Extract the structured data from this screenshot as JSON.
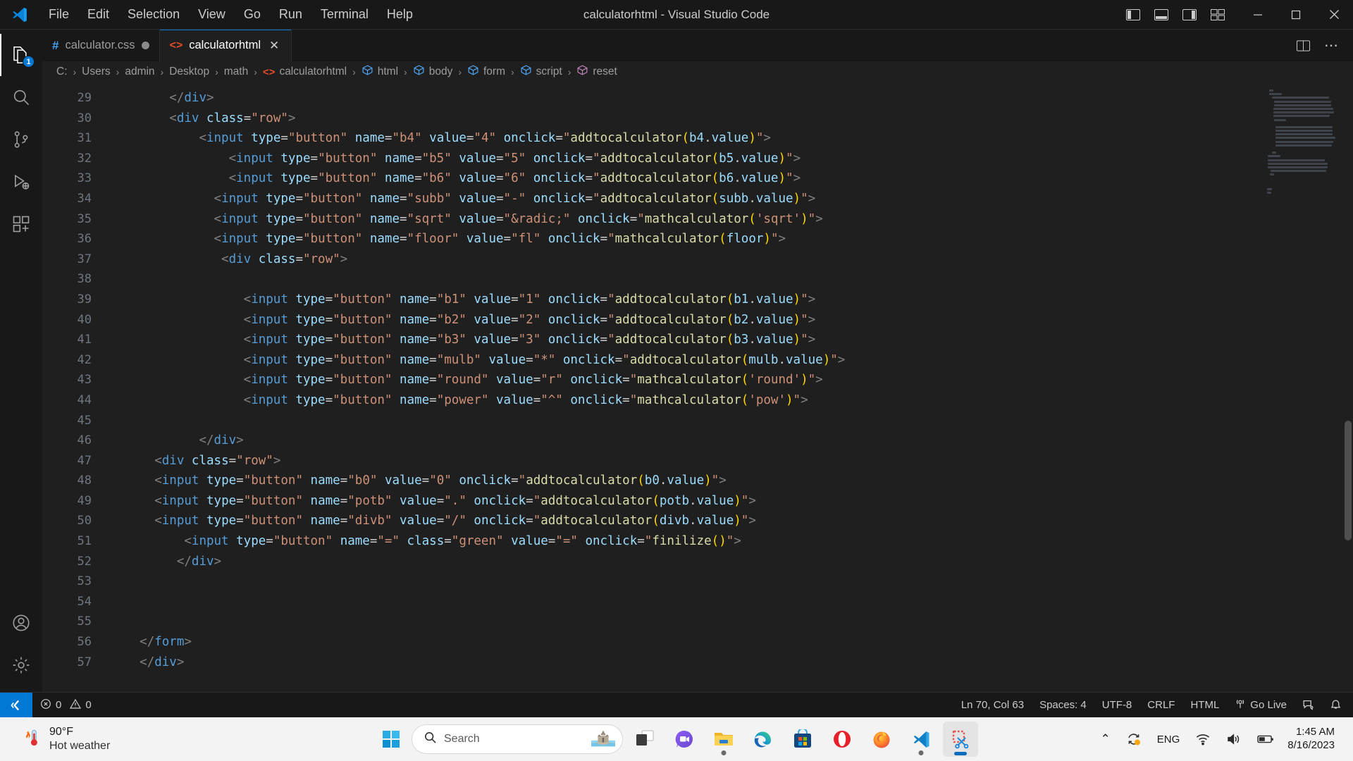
{
  "window": {
    "title": "calculatorhtml - Visual Studio Code",
    "menus": [
      "File",
      "Edit",
      "Selection",
      "View",
      "Go",
      "Run",
      "Terminal",
      "Help"
    ],
    "controls": {
      "minimize": "–",
      "maximize": "☐",
      "close": "✕"
    },
    "layout_icons": [
      "toggle-primary-sidebar-icon",
      "toggle-panel-icon",
      "toggle-secondary-sidebar-icon",
      "customize-layout-icon"
    ]
  },
  "activitybar": {
    "items": [
      {
        "name": "explorer",
        "badge": "1"
      },
      {
        "name": "search",
        "badge": ""
      },
      {
        "name": "source-control",
        "badge": ""
      },
      {
        "name": "run-and-debug",
        "badge": ""
      },
      {
        "name": "extensions",
        "badge": ""
      }
    ],
    "bottom": [
      {
        "name": "accounts"
      },
      {
        "name": "settings"
      }
    ]
  },
  "tabs": [
    {
      "label": "calculator.css",
      "icon": "css-file-icon",
      "dirty": true,
      "active": false
    },
    {
      "label": "calculatorhtml",
      "icon": "html-file-icon",
      "dirty": false,
      "active": true,
      "close": "✕"
    }
  ],
  "editor_actions": {
    "split_editor": "split-editor-icon",
    "more_actions": "⋯"
  },
  "breadcrumbs": [
    {
      "label": "C:",
      "icon": ""
    },
    {
      "label": "Users",
      "icon": ""
    },
    {
      "label": "admin",
      "icon": ""
    },
    {
      "label": "Desktop",
      "icon": ""
    },
    {
      "label": "math",
      "icon": ""
    },
    {
      "label": "calculatorhtml",
      "icon": "html-file-icon"
    },
    {
      "label": "html",
      "icon": "symbol-field-icon"
    },
    {
      "label": "body",
      "icon": "symbol-field-icon"
    },
    {
      "label": "form",
      "icon": "symbol-field-icon"
    },
    {
      "label": "script",
      "icon": "symbol-field-icon"
    },
    {
      "label": "reset",
      "icon": "symbol-object-icon"
    }
  ],
  "separator": "›",
  "code": {
    "first_line": 29,
    "lines": [
      {
        "n": 29,
        "text": "        </div>"
      },
      {
        "n": 30,
        "text": "        <div class=\"row\">"
      },
      {
        "n": 31,
        "text": "            <input type=\"button\" name=\"b4\" value=\"4\" onclick=\"addtocalculator(b4.value)\">"
      },
      {
        "n": 32,
        "text": "                <input type=\"button\" name=\"b5\" value=\"5\" onclick=\"addtocalculator(b5.value)\">"
      },
      {
        "n": 33,
        "text": "                <input type=\"button\" name=\"b6\" value=\"6\" onclick=\"addtocalculator(b6.value)\">"
      },
      {
        "n": 34,
        "text": "              <input type=\"button\" name=\"subb\" value=\"-\" onclick=\"addtocalculator(subb.value)\">"
      },
      {
        "n": 35,
        "text": "              <input type=\"button\" name=\"sqrt\" value=\"&radic;\" onclick=\"mathcalculator('sqrt')\">"
      },
      {
        "n": 36,
        "text": "              <input type=\"button\" name=\"floor\" value=\"fl\" onclick=\"mathcalculator(floor)\">"
      },
      {
        "n": 37,
        "text": "               <div class=\"row\">"
      },
      {
        "n": 38,
        "text": ""
      },
      {
        "n": 39,
        "text": "                  <input type=\"button\" name=\"b1\" value=\"1\" onclick=\"addtocalculator(b1.value)\">"
      },
      {
        "n": 40,
        "text": "                  <input type=\"button\" name=\"b2\" value=\"2\" onclick=\"addtocalculator(b2.value)\">"
      },
      {
        "n": 41,
        "text": "                  <input type=\"button\" name=\"b3\" value=\"3\" onclick=\"addtocalculator(b3.value)\">"
      },
      {
        "n": 42,
        "text": "                  <input type=\"button\" name=\"mulb\" value=\"*\" onclick=\"addtocalculator(mulb.value)\">"
      },
      {
        "n": 43,
        "text": "                  <input type=\"button\" name=\"round\" value=\"r\" onclick=\"mathcalculator('round')\">"
      },
      {
        "n": 44,
        "text": "                  <input type=\"button\" name=\"power\" value=\"^\" onclick=\"mathcalculator('pow')\">"
      },
      {
        "n": 45,
        "text": ""
      },
      {
        "n": 46,
        "text": "            </div>"
      },
      {
        "n": 47,
        "text": "      <div class=\"row\">"
      },
      {
        "n": 48,
        "text": "      <input type=\"button\" name=\"b0\" value=\"0\" onclick=\"addtocalculator(b0.value)\">"
      },
      {
        "n": 49,
        "text": "      <input type=\"button\" name=\"potb\" value=\".\" onclick=\"addtocalculator(potb.value)\">"
      },
      {
        "n": 50,
        "text": "      <input type=\"button\" name=\"divb\" value=\"/\" onclick=\"addtocalculator(divb.value)\">"
      },
      {
        "n": 51,
        "text": "          <input type=\"button\" name=\"=\" class=\"green\" value=\"=\" onclick=\"finilize()\">"
      },
      {
        "n": 52,
        "text": "         </div>"
      },
      {
        "n": 53,
        "text": ""
      },
      {
        "n": 54,
        "text": ""
      },
      {
        "n": 55,
        "text": ""
      },
      {
        "n": 56,
        "text": "    </form>"
      },
      {
        "n": 57,
        "text": "    </div>"
      }
    ]
  },
  "statusbar": {
    "remote_icon": "remote-window-icon",
    "errors": "0",
    "warnings": "0",
    "error_icon": "error-icon",
    "warning_icon": "warning-icon",
    "right": [
      {
        "name": "editor-position",
        "label": "Ln 70, Col 63"
      },
      {
        "name": "indentation",
        "label": "Spaces: 4"
      },
      {
        "name": "encoding",
        "label": "UTF-8"
      },
      {
        "name": "eol",
        "label": "CRLF"
      },
      {
        "name": "language-mode",
        "label": "HTML"
      },
      {
        "name": "go-live",
        "label": "Go Live",
        "icon": "broadcast-icon"
      }
    ],
    "feedback_icon": "feedback-icon",
    "notifications_icon": "bell-icon"
  },
  "taskbar": {
    "weather": {
      "temperature": "90°F",
      "description": "Hot weather",
      "icon": "thermometer-hot-icon"
    },
    "start": "windows-start-icon",
    "search": {
      "placeholder": "Search",
      "icon": "search-icon",
      "badge_icon": "castle-image-icon"
    },
    "apps": [
      {
        "name": "task-view",
        "running": false
      },
      {
        "name": "chat-teams",
        "running": false
      },
      {
        "name": "file-explorer",
        "running": true
      },
      {
        "name": "microsoft-edge",
        "running": false
      },
      {
        "name": "microsoft-store",
        "running": false
      },
      {
        "name": "opera-browser",
        "running": false
      },
      {
        "name": "firefox-browser",
        "running": true
      },
      {
        "name": "visual-studio-code",
        "running": true
      },
      {
        "name": "snipping-tool",
        "running": true,
        "active": true
      }
    ],
    "tray": {
      "overflow": "⌃",
      "language": "ENG",
      "sync_icon": "sync-icon",
      "wifi_icon": "wifi-icon",
      "volume_icon": "volume-icon",
      "battery_icon": "battery-icon",
      "time": "1:45 AM",
      "date": "8/16/2023"
    }
  },
  "colors": {
    "accent": "#0078d4",
    "editor_bg": "#1f1f1f",
    "chrome_bg": "#181818",
    "tag": "#569cd6",
    "attr": "#9cdcfe",
    "string": "#ce9178",
    "func": "#dcdcaa"
  }
}
